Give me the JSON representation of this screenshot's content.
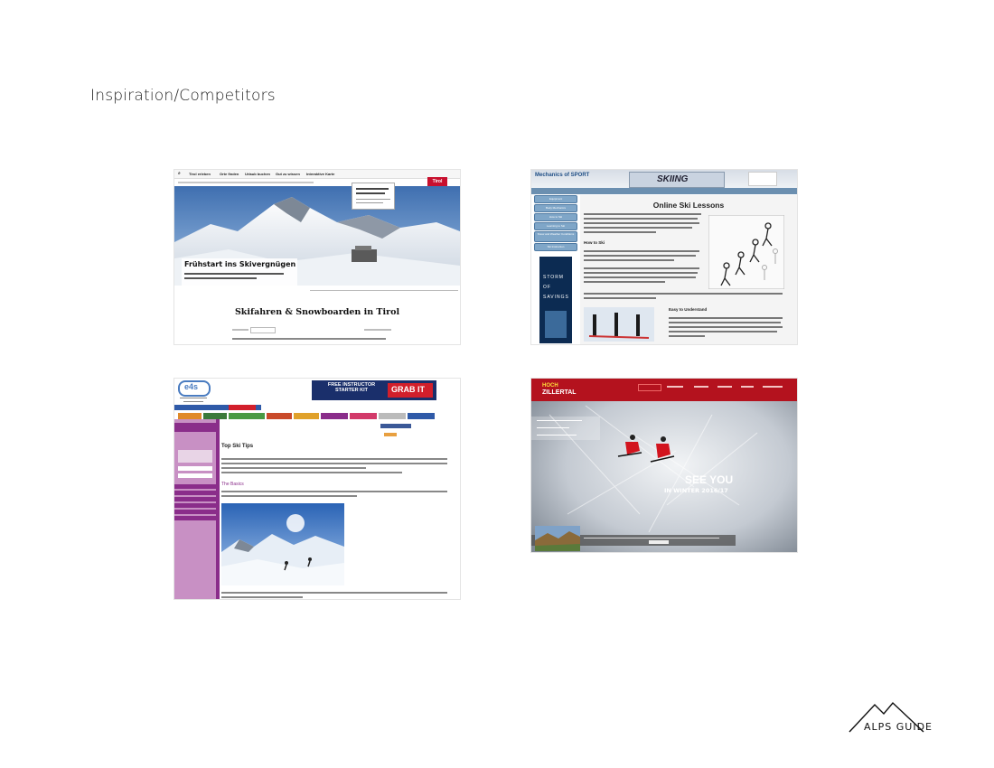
{
  "page_title": "Inspiration/Competitors",
  "brand": {
    "name": "ALPS GUIDE"
  },
  "screenshots": {
    "tirol": {
      "nav": [
        "Tirol erleben",
        "Orte finden",
        "Urlaub buchen",
        "Gut zu wissen",
        "Interaktive Karte"
      ],
      "hero_title": "Frühstart ins Skivergnügen",
      "heading": "Skifahren & Snowboarden in Tirol",
      "logo": "Tirol"
    },
    "mechanics_of_sport": {
      "logo": "Mechanics of SPORT",
      "banner": "SKIING",
      "title": "Online Ski Lessons",
      "subheads": [
        "How to Ski",
        "Easy to Understand"
      ],
      "sidebar": [
        "Equipment",
        "Body Mechanics",
        "How to Ski",
        "Learning to Ski",
        "Snow and Weather Conditions",
        "Ski Instruction"
      ],
      "ad_text": "STORM OF SAVINGS"
    },
    "els": {
      "logo": "e4s",
      "banner_text": "FREE INSTRUCTOR STARTER KIT",
      "banner_cta": "GRAB IT",
      "title": "Top Ski Tips",
      "subtitle": "The Basics"
    },
    "zillertal": {
      "logo_top": "HOCH",
      "logo_main": "ZILLERTAL",
      "headline": "SEE YOU",
      "subheadline": "IN WINTER 2016/17"
    }
  },
  "colors": {
    "tirol_red": "#c8102e",
    "els_purple": "#8a2d8a",
    "zillertal_red": "#b4121e",
    "mos_blue": "#6b8fb0"
  }
}
